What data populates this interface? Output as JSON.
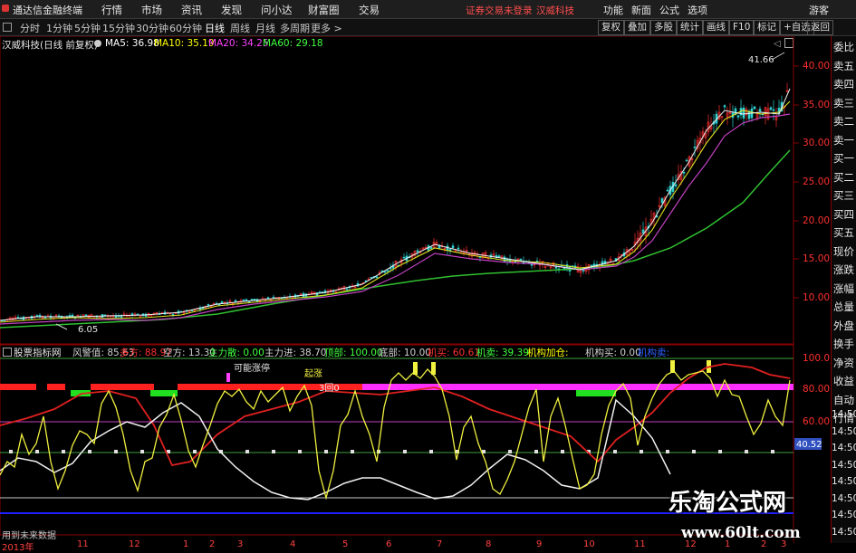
{
  "menubar": {
    "app_name": "通达信金融终端",
    "menus": [
      "行情",
      "市场",
      "资讯",
      "发现",
      "问小达",
      "财富圈",
      "交易"
    ],
    "notice_trade": "证券交易未登录",
    "notice_stock": "汉威科技",
    "right": [
      "功能",
      "新面",
      "公式",
      "选项"
    ],
    "guest": "游客"
  },
  "periodbar": {
    "periods": [
      "分时",
      "1分钟",
      "5分钟",
      "15分钟",
      "30分钟",
      "60分钟",
      "日线",
      "周线",
      "月线",
      "多周期",
      "更多 >"
    ],
    "active": "日线",
    "tools": [
      "复权",
      "叠加",
      "多股",
      "统计",
      "画线",
      "F10",
      "标记",
      "+自选",
      "返回"
    ]
  },
  "main_chart": {
    "title": "汉威科技(日线 前复权)",
    "ma": [
      {
        "label": "MA5: 36.98",
        "color": "#ffffff"
      },
      {
        "label": "MA10: 35.19",
        "color": "#ffff00"
      },
      {
        "label": "MA20: 34.25",
        "color": "#ff40ff"
      },
      {
        "label": "MA60: 29.18",
        "color": "#40ff40"
      }
    ],
    "price_axis": [
      "40.00",
      "35.00",
      "30.00",
      "25.00",
      "20.00",
      "15.00",
      "10.00"
    ],
    "high_label": "41.66",
    "low_label": "6.05"
  },
  "indicator": {
    "name": "股票指标网",
    "items": [
      {
        "label": "风警值: 85.63",
        "color": "#d0d0d0"
      },
      {
        "label": "多方: 88.97",
        "color": "#ff3030"
      },
      {
        "label": "空方: 13.30",
        "color": "#d0d0d0"
      },
      {
        "label": "主力散: 0.00",
        "color": "#40ff40"
      },
      {
        "label": "主力进: 38.70",
        "color": "#d0d0d0"
      },
      {
        "label": "顶部: 100.00",
        "color": "#40ff40"
      },
      {
        "label": "底部: 10.00",
        "color": "#d0d0d0"
      },
      {
        "label": "机买: 60.61",
        "color": "#ff3030"
      },
      {
        "label": "机卖: 39.39",
        "color": "#40ff40"
      },
      {
        "label": "机构加仓: ",
        "color": "#ffff00"
      },
      {
        "label": "机构买: 0.00",
        "color": "#d0d0d0"
      },
      {
        "label": "机构卖:",
        "color": "#3060ff"
      }
    ],
    "axis": [
      "100.0",
      "80.00",
      "60.00"
    ],
    "current_value": "40.52",
    "annotation_1": "可能涨停",
    "annotation_2": "起涨",
    "annotation_3": "3回0"
  },
  "sidebar": [
    "委比",
    "卖五",
    "卖四",
    "卖三",
    "卖二",
    "卖一",
    "买一",
    "买二",
    "买三",
    "买四",
    "买五",
    "现价",
    "涨跌",
    "涨幅",
    "总量",
    "外盘",
    "换手",
    "净资",
    "收益",
    "自动",
    "行情"
  ],
  "sidebar_times": [
    "14:50",
    "14:50",
    "14:50",
    "14:50",
    "14:50",
    "14:50",
    "14:50",
    "14:50"
  ],
  "bottom": {
    "note": "用到未来数据",
    "dates": [
      "2013年",
      "11",
      "12",
      "1",
      "2",
      "3",
      "4",
      "5",
      "6",
      "7",
      "8",
      "9",
      "10",
      "11",
      "12",
      "1",
      "2",
      "3"
    ]
  },
  "watermark": {
    "line1": "乐淘公式网",
    "line2": "www.60lt.com"
  }
}
